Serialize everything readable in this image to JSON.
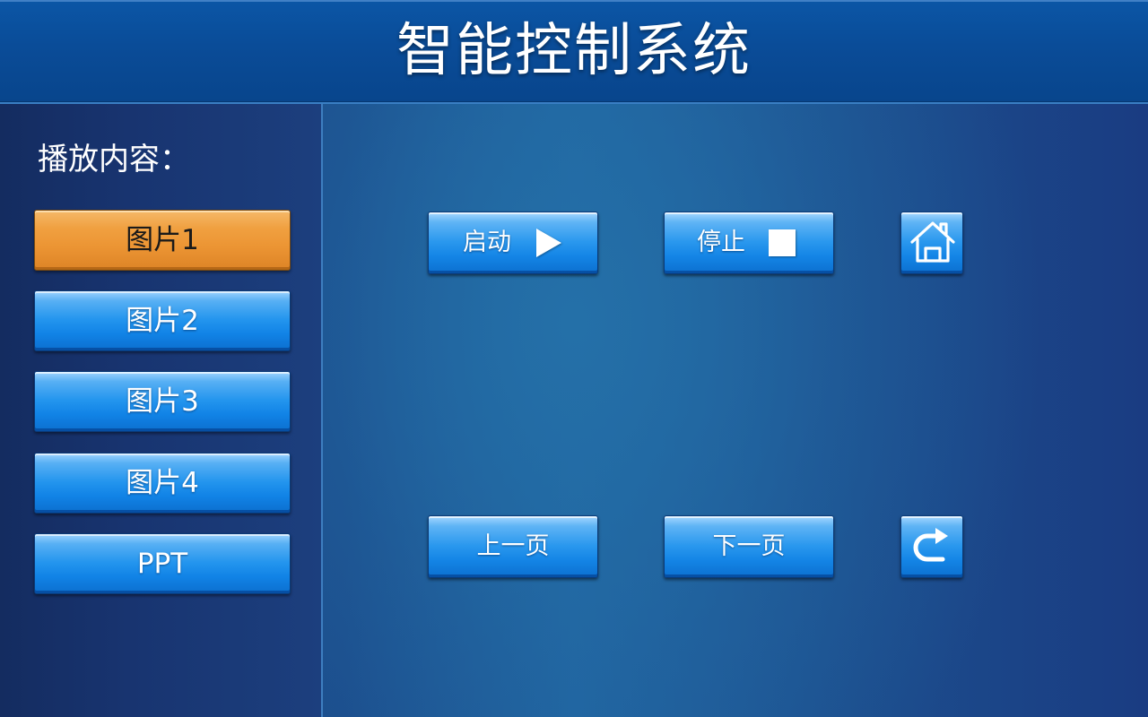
{
  "header": {
    "title": "智能控制系统"
  },
  "sidebar": {
    "label": "播放内容：",
    "items": [
      {
        "label": "图片1",
        "selected": true
      },
      {
        "label": "图片2",
        "selected": false
      },
      {
        "label": "图片3",
        "selected": false
      },
      {
        "label": "图片4",
        "selected": false
      },
      {
        "label": "PPT",
        "selected": false
      }
    ]
  },
  "controls": {
    "start_label": "启动",
    "stop_label": "停止",
    "prev_label": "上一页",
    "next_label": "下一页",
    "home_icon": "home-icon",
    "back_icon": "back-arrow-icon"
  },
  "colors": {
    "active_button": "#ec9534",
    "button": "#2395ee",
    "header": "#0a4c98"
  }
}
